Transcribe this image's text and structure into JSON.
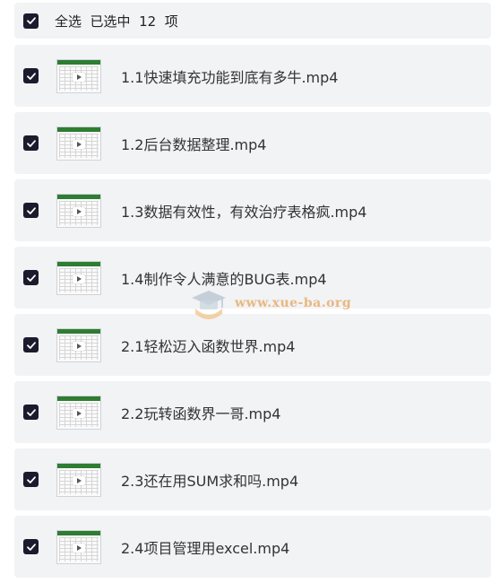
{
  "header": {
    "label": "全选  已选中  12  项"
  },
  "items": [
    {
      "name": "1.1快速填充功能到底有多牛.mp4"
    },
    {
      "name": "1.2后台数据整理.mp4"
    },
    {
      "name": "1.3数据有效性，有效治疗表格疯.mp4"
    },
    {
      "name": "1.4制作令人满意的BUG表.mp4"
    },
    {
      "name": "2.1轻松迈入函数世界.mp4"
    },
    {
      "name": "2.2玩转函数界一哥.mp4"
    },
    {
      "name": "2.3还在用SUM求和吗.mp4"
    },
    {
      "name": "2.4项目管理用excel.mp4"
    }
  ],
  "watermark": {
    "text": "www.xue-ba.org"
  },
  "colors": {
    "checkbox": "#1b1b2e",
    "row_bg": "#f2f3f5",
    "text": "#333333"
  },
  "icons": {
    "checkbox": "checkmark-icon",
    "thumbnail": "video-thumbnail-icon",
    "play": "play-icon"
  }
}
